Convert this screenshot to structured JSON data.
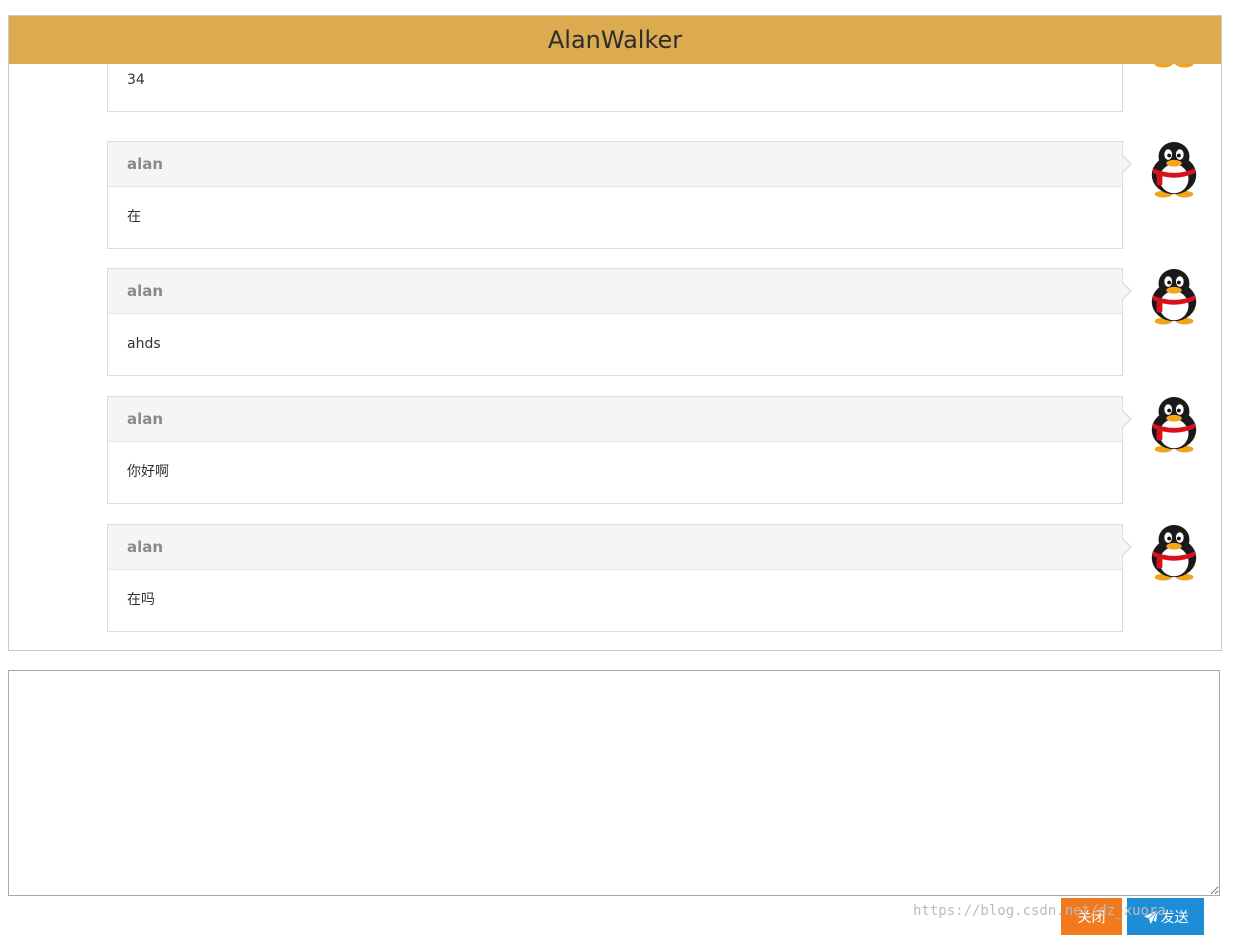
{
  "header": {
    "title": "AlanWalker"
  },
  "messages": [
    {
      "sender": "",
      "text": "34"
    },
    {
      "sender": "alan",
      "text": "在"
    },
    {
      "sender": "alan",
      "text": "ahds"
    },
    {
      "sender": "alan",
      "text": "你好啊"
    },
    {
      "sender": "alan",
      "text": "在吗"
    }
  ],
  "input": {
    "value": ""
  },
  "buttons": {
    "close_label": "关闭",
    "send_label": "发送"
  },
  "watermark": "https://blog.csdn.net/dz_xuora",
  "colors": {
    "header_bg": "#dcab4f",
    "close_button": "#f07a1d",
    "send_button": "#1d8dd6"
  },
  "icons": {
    "avatar": "qq-penguin-icon",
    "send": "paper-plane-icon"
  }
}
